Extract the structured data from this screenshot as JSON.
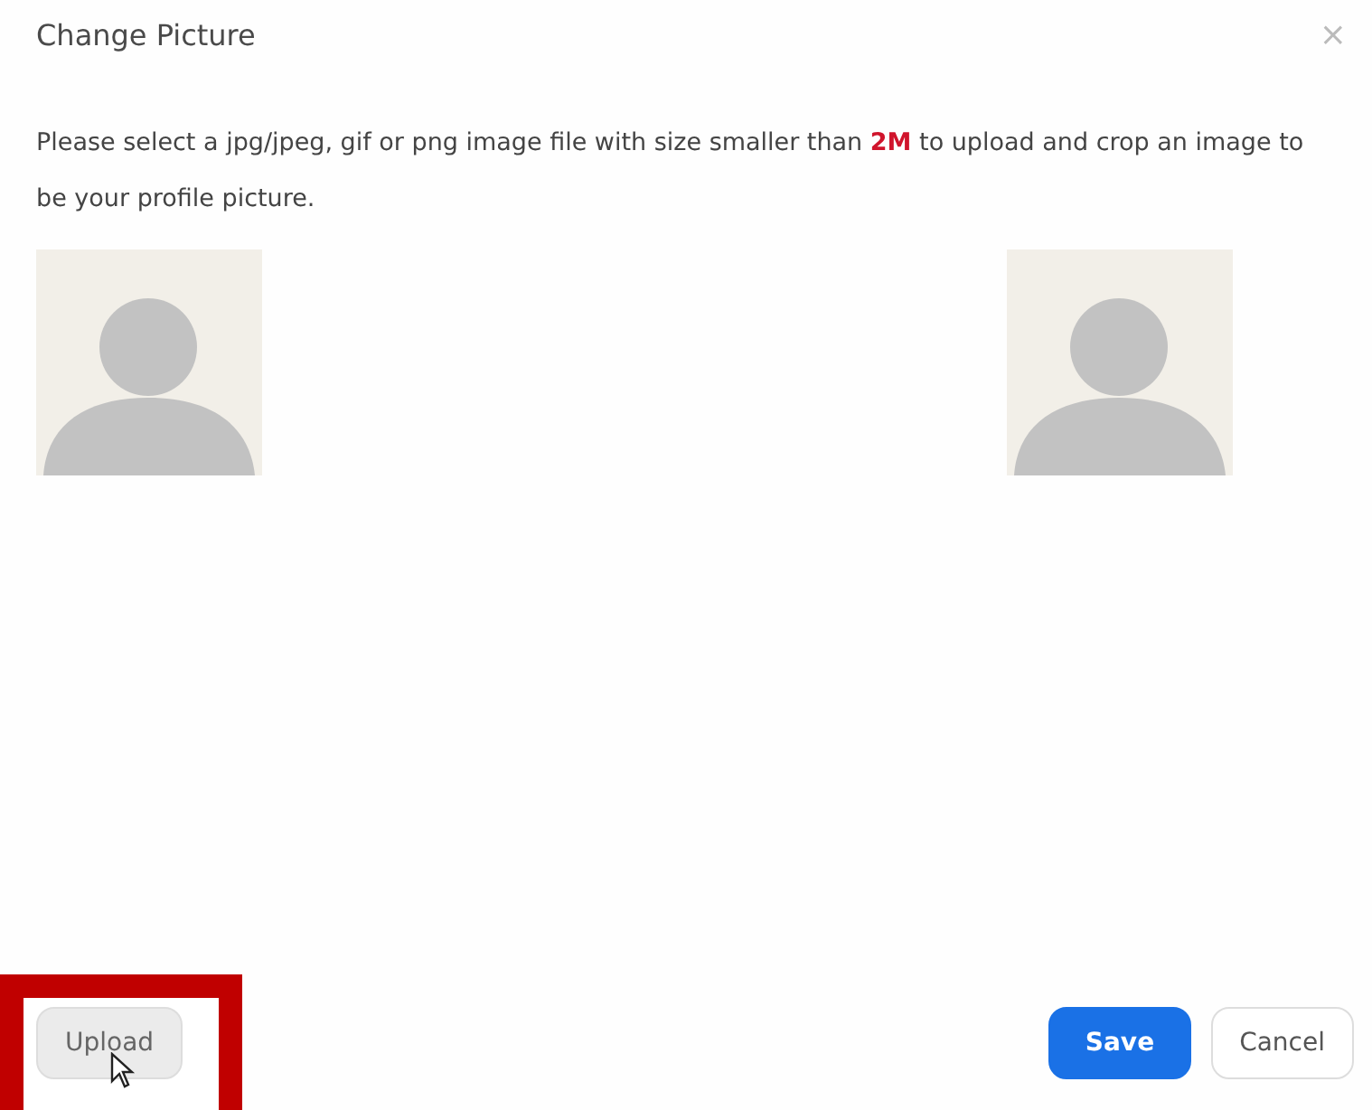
{
  "dialog": {
    "title": "Change Picture",
    "close": "×"
  },
  "instructions": "Please select a jpg/jpeg, gif or png image file with size smaller than **2M** to upload and crop an image to be your profile picture.",
  "previews": [
    {
      "kind": "avatar"
    },
    {
      "kind": "avatar"
    }
  ],
  "buttons": [
    {
      "label": "Upload",
      "kind": "secondary",
      "highlighted": true
    },
    {
      "label": "Save",
      "kind": "primary",
      "highlighted": false
    },
    {
      "label": "Cancel",
      "kind": "secondary",
      "highlighted": false
    }
  ]
}
